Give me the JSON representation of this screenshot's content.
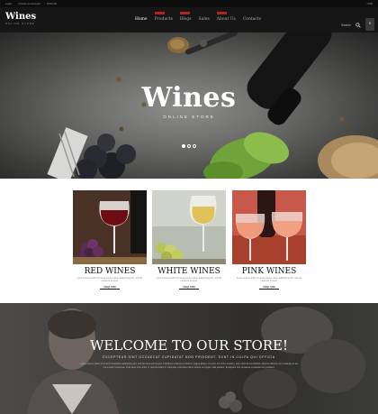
{
  "topbar": {
    "links": [
      "Login",
      "Create an account",
      "Wish list"
    ],
    "currency": "USD"
  },
  "header": {
    "logo_main": "Wines",
    "logo_sub": "ONLINE STORE",
    "nav": [
      {
        "label": "Home",
        "badge": false,
        "active": true
      },
      {
        "label": "Products",
        "badge": true,
        "active": false
      },
      {
        "label": "Blogs",
        "badge": true,
        "active": false
      },
      {
        "label": "Sales",
        "badge": false,
        "active": false
      },
      {
        "label": "About Us",
        "badge": true,
        "active": false
      },
      {
        "label": "Contacts",
        "badge": false,
        "active": false
      }
    ],
    "search_label": "Search",
    "cart_count": "0"
  },
  "hero": {
    "title": "Wines",
    "subtitle": "ONLINE STORE",
    "slides": 3,
    "active_slide": 1
  },
  "products": [
    {
      "title": "RED WINES",
      "description": "Lorem ipsum dolor sit amet conse ctetur adipisicing elit, sed do eiusmod tempor.",
      "link": "shop now"
    },
    {
      "title": "WHITE WINES",
      "description": "Lorem ipsum dolor sit amet conse ctetur adipisicing elit, sed do eiusmod tempor.",
      "link": "shop now"
    },
    {
      "title": "PINK WINES",
      "description": "Lorem ipsum dolor sit amet conse ctetur adipisicing elit, sed do eiusmod tempor.",
      "link": "shop now"
    }
  ],
  "welcome": {
    "title": "WELCOME TO OUR STORE!",
    "subtitle": "EXCEPTEUR SINT OCCAECAT CUPIDATAT NON PROIDENT, SUNT IN CULPA QUI OFFICIA",
    "text": "Lorem ipsum dolor sit amet consectetur adipisicing elit, sed do eiusmod tempor incididunt ut labore et dolore magna aliqua. Ut enim ad minim veniam, quis nostrud exercitation ullamco laboris nisi ut aliquip ex ea commodo consequat. Duis aute irure dolor in reprehenderit in voluptate velit esse cillum dolore eu fugiat nulla pariatur. Excepteur sint occaecat cupidatat non proident."
  },
  "colors": {
    "accent": "#b02424",
    "header_bg": "#161616",
    "topbar_bg": "#0d0d0d"
  },
  "icons": {
    "search": "search-icon",
    "cart": "cart-icon"
  }
}
